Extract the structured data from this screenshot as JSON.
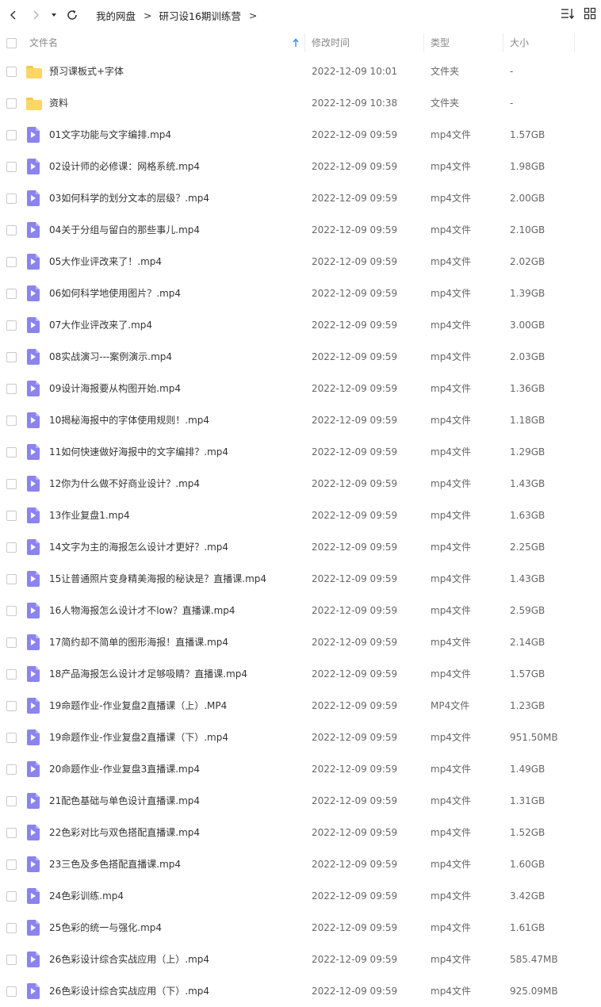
{
  "toolbar": {
    "back_icon": "chevron-left-icon",
    "forward_icon": "chevron-right-icon",
    "dropdown_icon": "caret-down-icon",
    "refresh_icon": "refresh-icon",
    "breadcrumb": [
      "我的网盘",
      "研习设16期训练营"
    ],
    "separator": ">",
    "sort_icon": "sort-list-icon",
    "view_icon": "grid-view-icon"
  },
  "header": {
    "name": "文件名",
    "modified": "修改时间",
    "type": "类型",
    "size": "大小",
    "sort_icon": "sort-arrow-up-icon",
    "sort_color": "#3d8eea"
  },
  "colors": {
    "folder": "#fdd663",
    "video": "#8b83ee"
  },
  "files": [
    {
      "name": "预习课板式+字体",
      "date": "2022-12-09 10:01",
      "type": "文件夹",
      "size": "-",
      "icon": "folder-icon"
    },
    {
      "name": "资料",
      "date": "2022-12-09 10:38",
      "type": "文件夹",
      "size": "-",
      "icon": "folder-icon"
    },
    {
      "name": "01文字功能与文字编排.mp4",
      "date": "2022-12-09 09:59",
      "type": "mp4文件",
      "size": "1.57GB",
      "icon": "video-file-icon"
    },
    {
      "name": "02设计师的必修课：网格系统.mp4",
      "date": "2022-12-09 09:59",
      "type": "mp4文件",
      "size": "1.98GB",
      "icon": "video-file-icon"
    },
    {
      "name": "03如何科学的划分文本的层级？.mp4",
      "date": "2022-12-09 09:59",
      "type": "mp4文件",
      "size": "2.00GB",
      "icon": "video-file-icon"
    },
    {
      "name": "04关于分组与留白的那些事儿.mp4",
      "date": "2022-12-09 09:59",
      "type": "mp4文件",
      "size": "2.10GB",
      "icon": "video-file-icon"
    },
    {
      "name": "05大作业评改来了！.mp4",
      "date": "2022-12-09 09:59",
      "type": "mp4文件",
      "size": "2.02GB",
      "icon": "video-file-icon"
    },
    {
      "name": "06如何科学地使用图片？.mp4",
      "date": "2022-12-09 09:59",
      "type": "mp4文件",
      "size": "1.39GB",
      "icon": "video-file-icon"
    },
    {
      "name": "07大作业评改来了.mp4",
      "date": "2022-12-09 09:59",
      "type": "mp4文件",
      "size": "3.00GB",
      "icon": "video-file-icon"
    },
    {
      "name": "08实战演习---案例演示.mp4",
      "date": "2022-12-09 09:59",
      "type": "mp4文件",
      "size": "2.03GB",
      "icon": "video-file-icon"
    },
    {
      "name": "09设计海报要从构图开始.mp4",
      "date": "2022-12-09 09:59",
      "type": "mp4文件",
      "size": "1.36GB",
      "icon": "video-file-icon"
    },
    {
      "name": "10揭秘海报中的字体使用规则！.mp4",
      "date": "2022-12-09 09:59",
      "type": "mp4文件",
      "size": "1.18GB",
      "icon": "video-file-icon"
    },
    {
      "name": "11如何快速做好海报中的文字编排？.mp4",
      "date": "2022-12-09 09:59",
      "type": "mp4文件",
      "size": "1.29GB",
      "icon": "video-file-icon"
    },
    {
      "name": "12你为什么做不好商业设计？.mp4",
      "date": "2022-12-09 09:59",
      "type": "mp4文件",
      "size": "1.43GB",
      "icon": "video-file-icon"
    },
    {
      "name": "13作业复盘1.mp4",
      "date": "2022-12-09 09:59",
      "type": "mp4文件",
      "size": "1.63GB",
      "icon": "video-file-icon"
    },
    {
      "name": "14文字为主的海报怎么设计才更好？.mp4",
      "date": "2022-12-09 09:59",
      "type": "mp4文件",
      "size": "2.25GB",
      "icon": "video-file-icon"
    },
    {
      "name": "15让普通照片变身精美海报的秘诀是？直播课.mp4",
      "date": "2022-12-09 09:59",
      "type": "mp4文件",
      "size": "1.43GB",
      "icon": "video-file-icon"
    },
    {
      "name": "16人物海报怎么设计才不low？直播课.mp4",
      "date": "2022-12-09 09:59",
      "type": "mp4文件",
      "size": "2.59GB",
      "icon": "video-file-icon"
    },
    {
      "name": "17简约却不简单的图形海报！直播课.mp4",
      "date": "2022-12-09 09:59",
      "type": "mp4文件",
      "size": "2.14GB",
      "icon": "video-file-icon"
    },
    {
      "name": "18产品海报怎么设计才足够吸睛？直播课.mp4",
      "date": "2022-12-09 09:59",
      "type": "mp4文件",
      "size": "1.57GB",
      "icon": "video-file-icon"
    },
    {
      "name": "19命题作业-作业复盘2直播课（上）.MP4",
      "date": "2022-12-09 09:59",
      "type": "MP4文件",
      "size": "1.23GB",
      "icon": "video-file-icon"
    },
    {
      "name": "19命题作业-作业复盘2直播课（下）.mp4",
      "date": "2022-12-09 09:59",
      "type": "mp4文件",
      "size": "951.50MB",
      "icon": "video-file-icon"
    },
    {
      "name": "20命题作业-作业复盘3直播课.mp4",
      "date": "2022-12-09 09:59",
      "type": "mp4文件",
      "size": "1.49GB",
      "icon": "video-file-icon"
    },
    {
      "name": "21配色基础与单色设计直播课.mp4",
      "date": "2022-12-09 09:59",
      "type": "mp4文件",
      "size": "1.31GB",
      "icon": "video-file-icon"
    },
    {
      "name": "22色彩对比与双色搭配直播课.mp4",
      "date": "2022-12-09 09:59",
      "type": "mp4文件",
      "size": "1.52GB",
      "icon": "video-file-icon"
    },
    {
      "name": "23三色及多色搭配直播课.mp4",
      "date": "2022-12-09 09:59",
      "type": "mp4文件",
      "size": "1.60GB",
      "icon": "video-file-icon"
    },
    {
      "name": "24色彩训练.mp4",
      "date": "2022-12-09 09:59",
      "type": "mp4文件",
      "size": "3.42GB",
      "icon": "video-file-icon"
    },
    {
      "name": "25色彩的统一与强化.mp4",
      "date": "2022-12-09 09:59",
      "type": "mp4文件",
      "size": "1.61GB",
      "icon": "video-file-icon"
    },
    {
      "name": "26色彩设计综合实战应用（上）.mp4",
      "date": "2022-12-09 09:59",
      "type": "mp4文件",
      "size": "585.47MB",
      "icon": "video-file-icon"
    },
    {
      "name": "26色彩设计综合实战应用（下）.mp4",
      "date": "2022-12-09 09:59",
      "type": "mp4文件",
      "size": "925.09MB",
      "icon": "video-file-icon"
    }
  ]
}
